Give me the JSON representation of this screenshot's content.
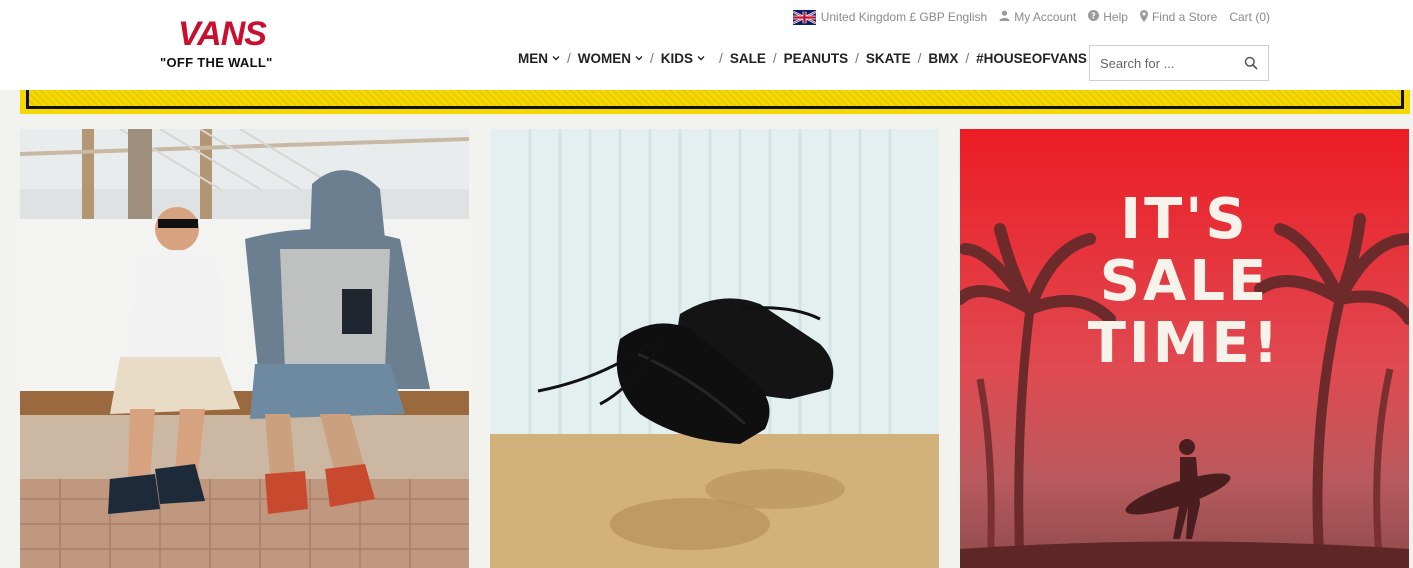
{
  "brand": {
    "name": "VANS",
    "tagline": "\"OFF THE WALL\"",
    "color": "#c8102e"
  },
  "utility": {
    "locale": "United Kingdom £ GBP English",
    "account": "My Account",
    "help": "Help",
    "find_store": "Find a Store",
    "cart": "Cart (0)"
  },
  "nav": {
    "items": [
      {
        "label": "MEN",
        "dropdown": true
      },
      {
        "label": "WOMEN",
        "dropdown": true
      },
      {
        "label": "KIDS",
        "dropdown": true
      },
      {
        "label": "SALE",
        "dropdown": false
      },
      {
        "label": "PEANUTS",
        "dropdown": false
      },
      {
        "label": "SKATE",
        "dropdown": false
      },
      {
        "label": "BMX",
        "dropdown": false
      },
      {
        "label": "#HOUSEOFVANS",
        "dropdown": false
      }
    ]
  },
  "search": {
    "placeholder": "Search for ...",
    "icon": "search-icon"
  },
  "promo": {
    "color": "#f5d800"
  },
  "tiles": [
    {
      "name": "lifestyle-men-photo"
    },
    {
      "name": "black-sneakers-photo"
    },
    {
      "name": "sale-promo",
      "headline": [
        "IT'S",
        "SALE",
        "TIME!"
      ],
      "color": "#e3202a"
    }
  ]
}
